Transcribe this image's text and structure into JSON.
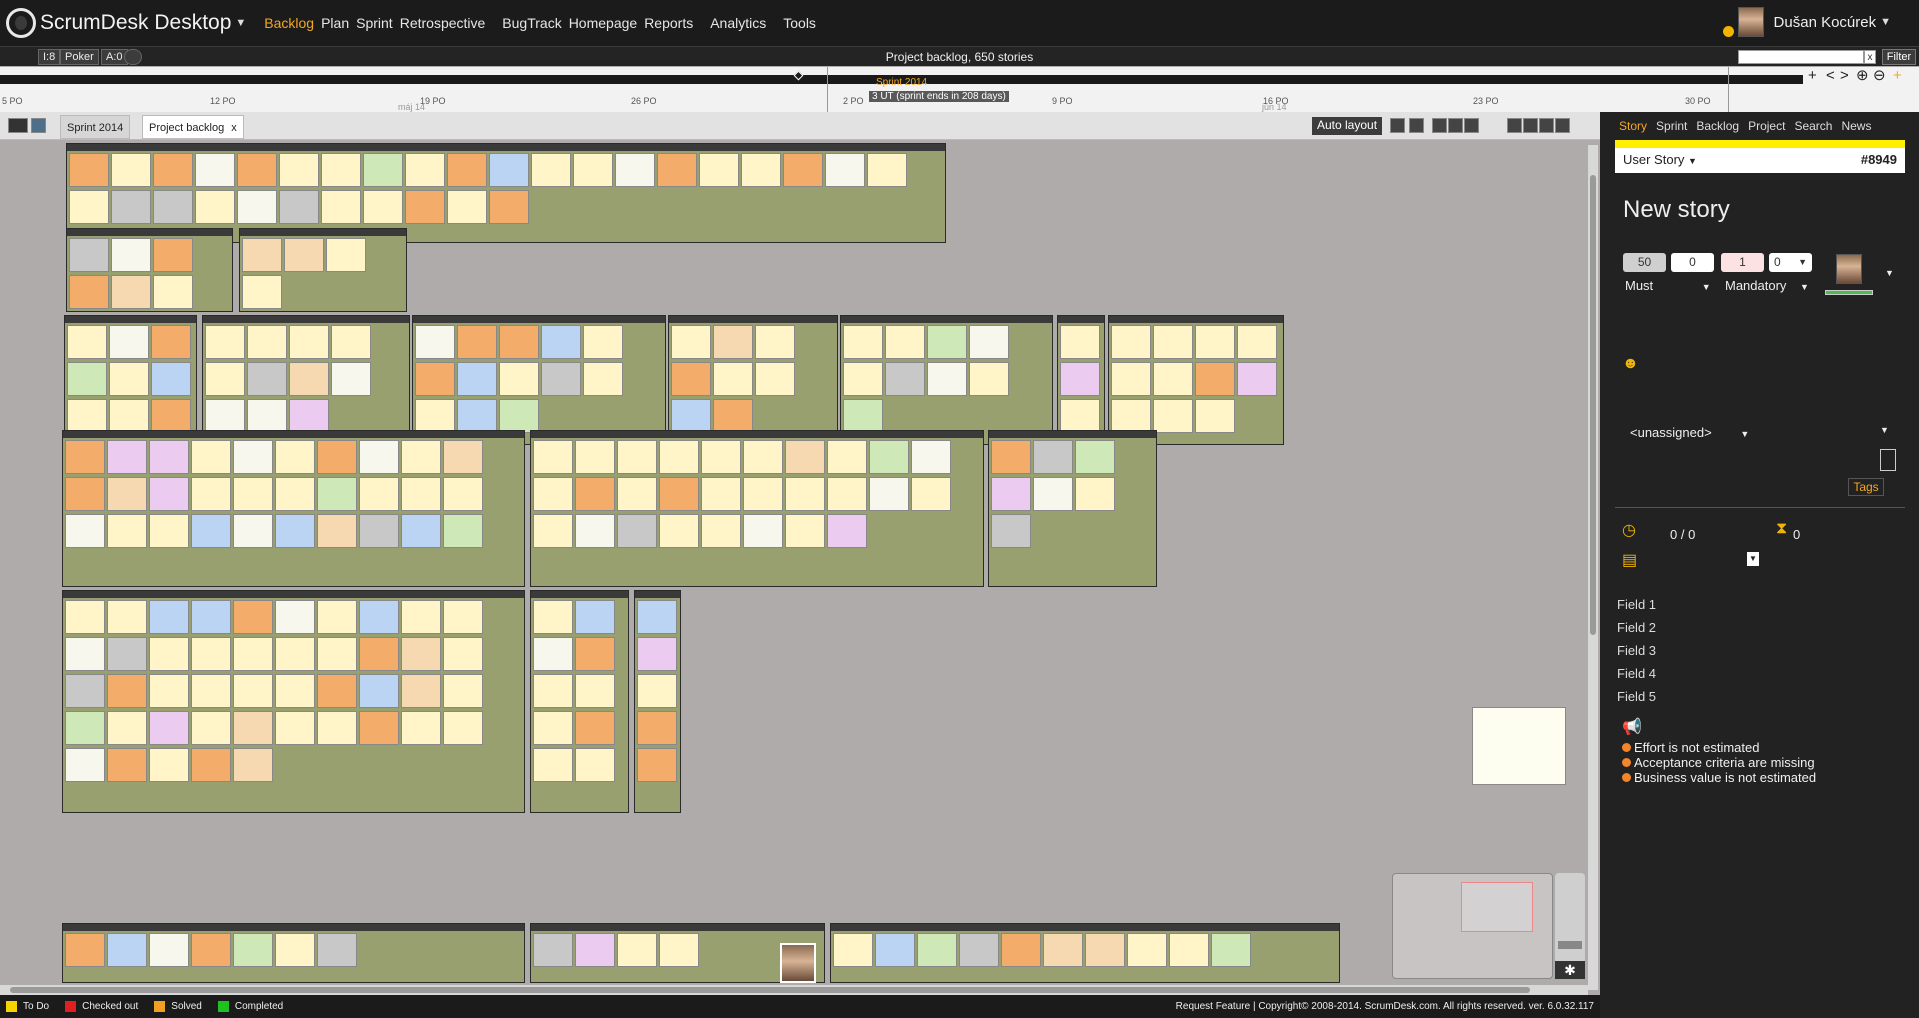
{
  "app": {
    "title": "ScrumDesk Desktop"
  },
  "menu": [
    "Backlog",
    "Plan",
    "Sprint",
    "Retrospective",
    "BugTrack",
    "Homepage",
    "Reports",
    "Analytics",
    "Tools"
  ],
  "menu_active": "Backlog",
  "user": {
    "name": "Dušan Kocúrek"
  },
  "toolbar": {
    "chip1": "I:8",
    "chip2": "Poker",
    "chip3": "A:0",
    "title": "Project backlog,  650 stories",
    "filter": "Filter",
    "clear": "x"
  },
  "timeline": {
    "ticks": [
      "5 PO",
      "12 PO",
      "19 PO",
      "26 PO",
      "2 PO",
      "9 PO",
      "16 PO",
      "23 PO",
      "30 PO"
    ],
    "months": [
      "máj 14",
      "jún 14"
    ],
    "sprint": "Sprint 2014",
    "sprint_info": "3 UT (sprint ends in 208 days)"
  },
  "tabs": {
    "sprint": "Sprint 2014",
    "backlog": "Project backlog",
    "close": "x",
    "auto_layout": "Auto layout"
  },
  "legend": [
    {
      "label": "To Do",
      "color": "#f5d400"
    },
    {
      "label": "Checked out",
      "color": "#e02020"
    },
    {
      "label": "Solved",
      "color": "#f0a020"
    },
    {
      "label": "Completed",
      "color": "#20c020"
    }
  ],
  "footer": {
    "copyright": "Request Feature | Copyright© 2008-2014. ScrumDesk.com. All rights reserved. ver. 6.0.32.117"
  },
  "panel": {
    "tabs": [
      "Story",
      "Sprint",
      "Backlog",
      "Project",
      "Search",
      "News"
    ],
    "type": "User Story",
    "id": "#8949",
    "heading": "New story",
    "values": [
      "50",
      "0",
      "1",
      "0"
    ],
    "priority": "Must",
    "mandatory": "Mandatory",
    "unassigned": "<unassigned>",
    "tags": "Tags",
    "time": "0 / 0",
    "remaining": "0",
    "fields": [
      "Field 1",
      "Field 2",
      "Field 3",
      "Field 4",
      "Field 5"
    ],
    "warnings": [
      "Effort is not estimated",
      "Acceptance criteria are missing",
      "Business value is not estimated"
    ]
  }
}
